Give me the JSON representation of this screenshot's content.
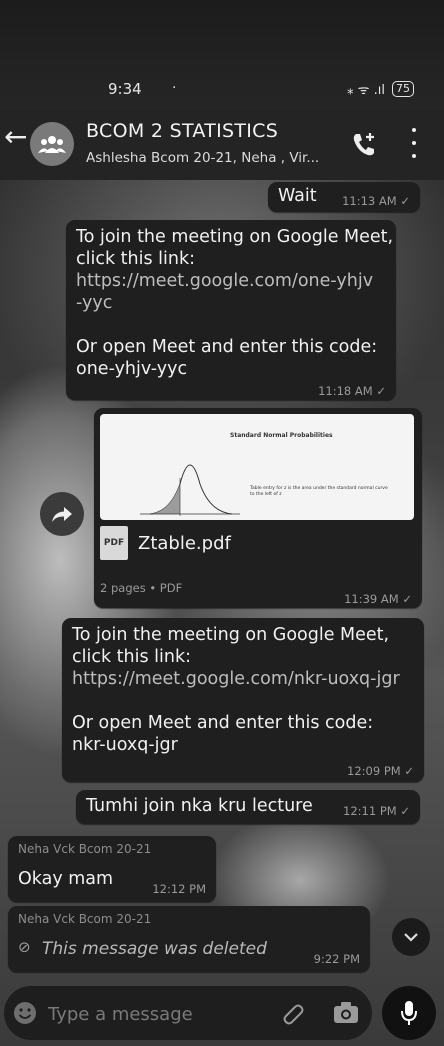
{
  "status_bar": {
    "time": "9:34",
    "indicators": "·",
    "signal": "⁎ ᯤ .ıl",
    "battery": "75"
  },
  "header": {
    "title": "BCOM 2 STATISTICS",
    "subtitle": "Ashlesha Bcom 20-21, Neha , Vir..."
  },
  "messages": [
    {
      "text": "Wait",
      "time": "11:13 AM ✓"
    },
    {
      "line1": "To join the meeting on Google Meet,",
      "line2": "click this link:",
      "link": "https://meet.google.com/one-yhjv\n-yyc",
      "line3": "Or open Meet and enter this code:",
      "code": "one-yhjv-yyc",
      "time": "11:18 AM ✓"
    },
    {
      "pdf_heading": "Standard Normal Probabilities",
      "pdf_desc": "Table entry for z is the area under the standard normal curve to the left of z",
      "file_name": "Ztable.pdf",
      "file_badge": "PDF",
      "file_meta": "2 pages • PDF",
      "time": "11:39 AM ✓"
    },
    {
      "line1": "To join the meeting on Google Meet,",
      "line2": "click this link:",
      "link": "https://meet.google.com/nkr-uoxq-jgr",
      "line3": "Or open Meet and enter this code:",
      "code": "nkr-uoxq-jgr",
      "time": "12:09 PM ✓"
    },
    {
      "text": "Tumhi join nka kru lecture",
      "time": "12:11 PM ✓"
    },
    {
      "sender": "Neha Vck Bcom 20-21",
      "text": "Okay mam",
      "time": "12:12 PM"
    },
    {
      "sender": "Neha Vck Bcom 20-21",
      "text": "This message was deleted",
      "time": "9:22 PM"
    }
  ],
  "composer": {
    "placeholder": "Type a message"
  },
  "icons": {
    "back": "arrow-left",
    "call": "add-call",
    "menu": "more-vertical",
    "share": "forward",
    "scroll": "chevron-down",
    "emoji": "smiley",
    "attach": "paperclip",
    "camera": "camera",
    "mic": "microphone"
  }
}
